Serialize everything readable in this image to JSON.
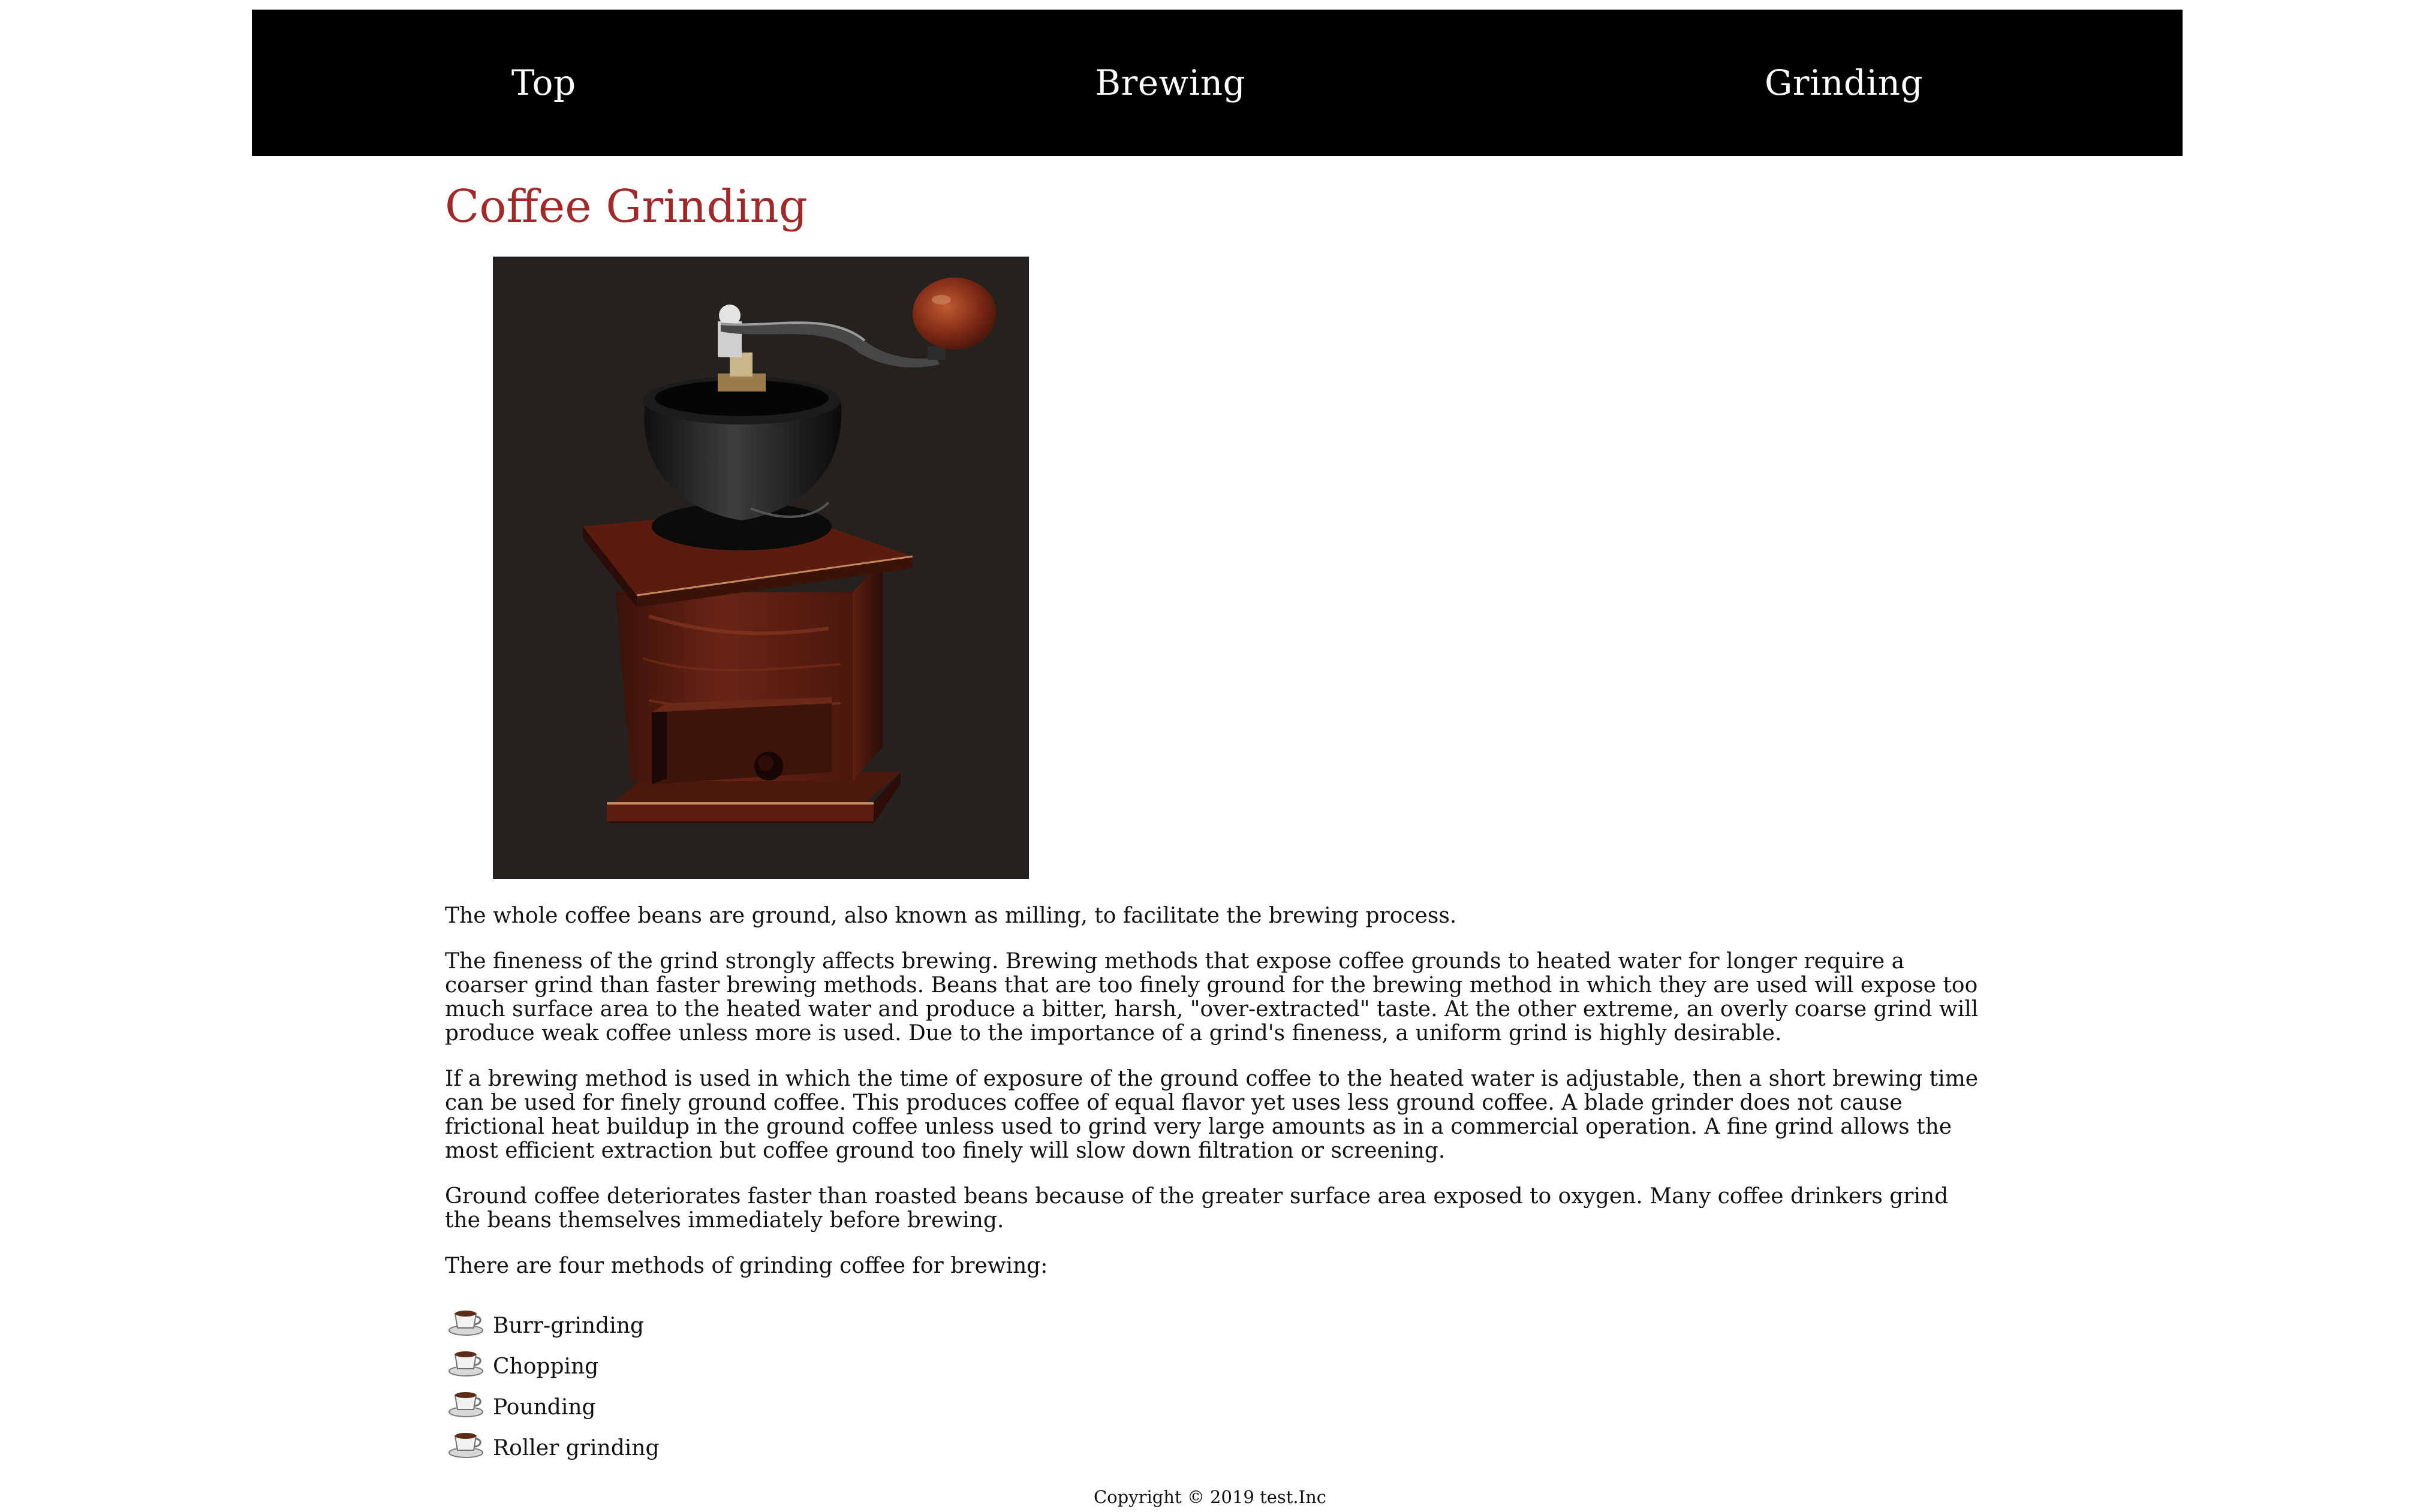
{
  "nav": {
    "items": [
      {
        "label": "Top"
      },
      {
        "label": "Brewing"
      },
      {
        "label": "Grinding"
      }
    ]
  },
  "main": {
    "title": "Coffee Grinding",
    "image_alt": "coffee grinder",
    "paragraphs": [
      "The whole coffee beans are ground, also known as milling, to facilitate the brewing process.",
      "The fineness of the grind strongly affects brewing. Brewing methods that expose coffee grounds to heated water for longer require a coarser grind than faster brewing methods. Beans that are too finely ground for the brewing method in which they are used will expose too much surface area to the heated water and produce a bitter, harsh, \"over-extracted\" taste. At the other extreme, an overly coarse grind will produce weak coffee unless more is used. Due to the importance of a grind's fineness, a uniform grind is highly desirable.",
      "If a brewing method is used in which the time of exposure of the ground coffee to the heated water is adjustable, then a short brewing time can be used for finely ground coffee. This produces coffee of equal flavor yet uses less ground coffee. A blade grinder does not cause frictional heat buildup in the ground coffee unless used to grind very large amounts as in a commercial operation. A fine grind allows the most efficient extraction but coffee ground too finely will slow down filtration or screening.",
      "Ground coffee deteriorates faster than roasted beans because of the greater surface area exposed to oxygen. Many coffee drinkers grind the beans themselves immediately before brewing.",
      "There are four methods of grinding coffee for brewing:"
    ],
    "methods": [
      {
        "label": "Burr-grinding",
        "icon": "coffee-cup-icon"
      },
      {
        "label": "Chopping",
        "icon": "coffee-cup-icon"
      },
      {
        "label": "Pounding",
        "icon": "coffee-cup-icon"
      },
      {
        "label": "Roller grinding",
        "icon": "coffee-cup-icon"
      }
    ]
  },
  "footer": {
    "copyright": "Copyright © 2019 test.Inc"
  },
  "colors": {
    "nav_background": "#000000",
    "title": "#a02a2a",
    "text": "#111111",
    "image_background": "#23211f"
  }
}
